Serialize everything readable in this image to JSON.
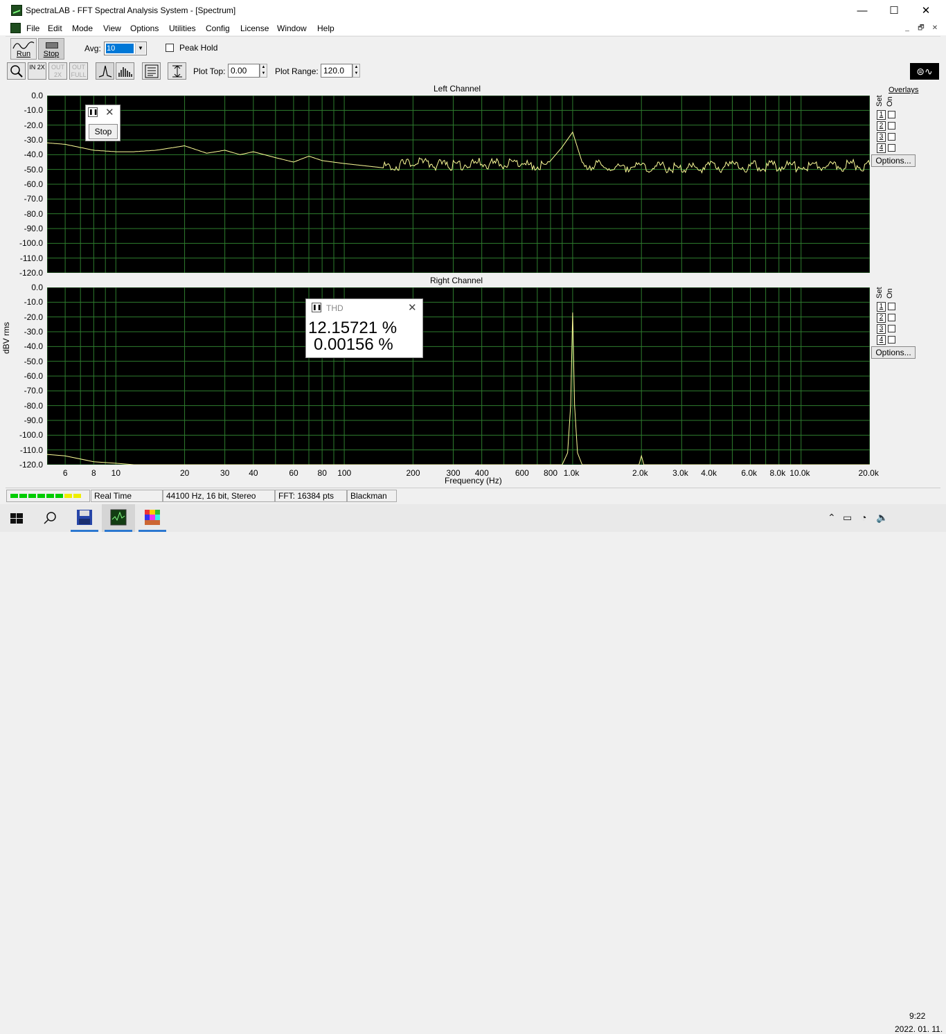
{
  "window": {
    "title": "SpectraLAB - FFT Spectral Analysis System - [Spectrum]",
    "controls": {
      "minimize": "—",
      "maximize": "☐",
      "close": "✕"
    }
  },
  "menu": {
    "items": [
      "File",
      "Edit",
      "Mode",
      "View",
      "Options",
      "Utilities",
      "Config",
      "License",
      "Window",
      "Help"
    ],
    "mdi": {
      "minimize": "_",
      "restore": "🗗",
      "close": "✕"
    }
  },
  "toolbar1": {
    "run_label": "Run",
    "stop_label": "Stop",
    "avg_label": "Avg:",
    "avg_value": "10",
    "peak_hold_label": "Peak Hold",
    "peak_hold_checked": false
  },
  "toolbar2": {
    "zoom_in_label": "IN 2X",
    "zoom_in2_label": "OUT 2X",
    "zoom_out_full_label": "OUT FULL",
    "plot_top_label": "Plot Top:",
    "plot_top_value": "0.00",
    "plot_range_label": "Plot Range:",
    "plot_range_value": "120.0"
  },
  "plots": {
    "y_axis_label": "dBV rms",
    "x_axis_label": "Frequency (Hz)",
    "y_ticks": [
      "0.0",
      "-10.0",
      "-20.0",
      "-30.0",
      "-40.0",
      "-50.0",
      "-60.0",
      "-70.0",
      "-80.0",
      "-90.0",
      "-100.0",
      "-110.0",
      "-120.0"
    ],
    "x_ticks": [
      "6",
      "8",
      "10",
      "20",
      "30",
      "40",
      "60",
      "80",
      "100",
      "200",
      "300",
      "400",
      "600",
      "800",
      "1.0k",
      "2.0k",
      "3.0k",
      "4.0k",
      "6.0k",
      "8.0k",
      "10.0k",
      "20.0k"
    ],
    "left_title": "Left Channel",
    "right_title": "Right Channel",
    "overlays_label": "Overlays",
    "set_label": "Set",
    "on_label": "On",
    "overlay_rows": [
      "1",
      "2",
      "3",
      "4"
    ],
    "options_label": "Options...",
    "colors": {
      "plot_bg": "#000000",
      "grid": "#2e7d2e",
      "trace": "#ffff99"
    }
  },
  "chart_data": [
    {
      "type": "line",
      "title": "Left Channel",
      "xlabel": "Frequency (Hz)",
      "ylabel": "dBV rms",
      "xscale": "log",
      "xlim": [
        5,
        20000
      ],
      "ylim": [
        -120,
        0
      ],
      "series": [
        {
          "x": [
            5,
            6,
            8,
            10,
            12,
            15,
            20,
            25,
            30,
            35,
            40,
            50,
            60,
            70,
            80,
            100,
            150,
            200,
            300,
            400,
            600,
            800,
            1000,
            1100,
            1500,
            2000,
            3000,
            5000,
            10000,
            20000
          ],
          "y": [
            -32,
            -33,
            -37,
            -38,
            -38,
            -37,
            -34,
            -39,
            -37,
            -40,
            -38,
            -42,
            -45,
            -41,
            -44,
            -46,
            -49,
            -46,
            -47,
            -46,
            -47,
            -47,
            -22,
            -47,
            -48,
            -48,
            -49,
            -48,
            -48,
            -47
          ]
        }
      ]
    },
    {
      "type": "line",
      "title": "Right Channel",
      "xlabel": "Frequency (Hz)",
      "ylabel": "dBV rms",
      "xscale": "log",
      "xlim": [
        5,
        20000
      ],
      "ylim": [
        -120,
        0
      ],
      "series": [
        {
          "x": [
            5,
            6,
            8,
            10,
            12,
            20,
            900,
            950,
            980,
            1000,
            1020,
            1050,
            1100,
            1950,
            2000,
            2050,
            20000
          ],
          "y": [
            -113,
            -114,
            -118,
            -119,
            -120,
            -120,
            -120,
            -112,
            -80,
            -17,
            -80,
            -112,
            -120,
            -120,
            -114,
            -120,
            -120
          ]
        }
      ]
    }
  ],
  "stop_dialog": {
    "button_label": "Stop"
  },
  "thd_dialog": {
    "title": "THD",
    "value1": "12.15721 %",
    "value2": "0.00156 %"
  },
  "status": {
    "mode": "Real Time",
    "format": "44100 Hz, 16 bit, Stereo",
    "fft": "FFT: 16384 pts",
    "window": "Blackman",
    "led_colors": [
      "#00cc00",
      "#00cc00",
      "#00cc00",
      "#00cc00",
      "#00cc00",
      "#00cc00",
      "#eeee00",
      "#eeee00"
    ]
  },
  "taskbar": {
    "time": "9:22",
    "date": "2022. 01. 11."
  }
}
